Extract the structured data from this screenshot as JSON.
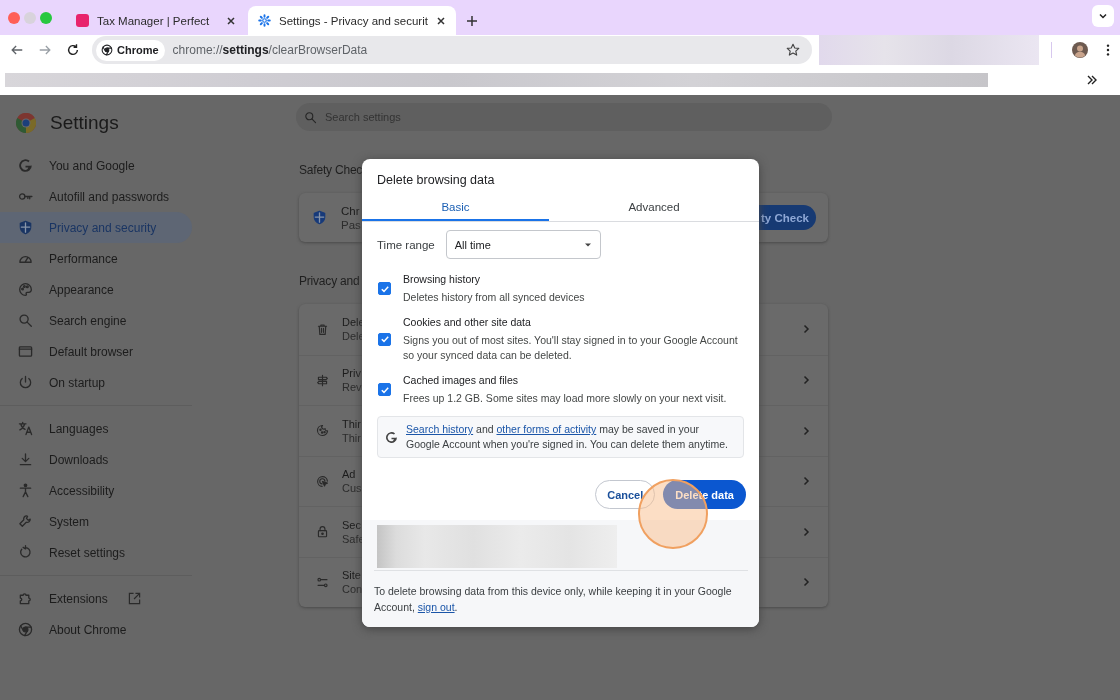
{
  "browser": {
    "tabs": [
      {
        "title": "Tax Manager | Perfect",
        "selected": false
      },
      {
        "title": "Settings - Privacy and securit",
        "selected": true
      }
    ],
    "omnibox": {
      "chip": "Chrome",
      "url": "chrome://**settings**/clearBrowserData"
    }
  },
  "settings": {
    "title": "Settings",
    "search": {
      "placeholder": "Search settings"
    },
    "sidebar": {
      "groups": [
        [
          {
            "label": "You and Google",
            "selected": false
          },
          {
            "label": "Autofill and passwords",
            "selected": false
          },
          {
            "label": "Privacy and security",
            "selected": true
          },
          {
            "label": "Performance",
            "selected": false
          },
          {
            "label": "Appearance",
            "selected": false
          },
          {
            "label": "Search engine",
            "selected": false
          },
          {
            "label": "Default browser",
            "selected": false
          },
          {
            "label": "On startup",
            "selected": false
          }
        ],
        [
          {
            "label": "Languages",
            "selected": false
          },
          {
            "label": "Downloads",
            "selected": false
          },
          {
            "label": "Accessibility",
            "selected": false
          },
          {
            "label": "System",
            "selected": false
          },
          {
            "label": "Reset settings",
            "selected": false
          }
        ],
        [
          {
            "label": "Extensions",
            "selected": false,
            "external": true
          },
          {
            "label": "About Chrome",
            "selected": false
          }
        ]
      ]
    },
    "safety_check": {
      "heading": "Safety Chec",
      "card_title": "Chr",
      "card_subtitle": "Pas",
      "button": "ty Check"
    },
    "privacy": {
      "heading": "Privacy and",
      "rows": [
        {
          "title": "Dele",
          "subtitle": "Dele"
        },
        {
          "title": "Priv",
          "subtitle": "Rev"
        },
        {
          "title": "Thir",
          "subtitle": "Thir"
        },
        {
          "title": "Ad",
          "subtitle": "Cus"
        },
        {
          "title": "Sec",
          "subtitle": "Safe"
        },
        {
          "title": "Site",
          "subtitle": "Con"
        }
      ]
    }
  },
  "dialog": {
    "title": "Delete browsing data",
    "tabs": [
      {
        "label": "Basic",
        "selected": true
      },
      {
        "label": "Advanced",
        "selected": false
      }
    ],
    "time_range": {
      "label": "Time range",
      "value": "All time"
    },
    "options": [
      {
        "title": "Browsing history",
        "description": "Deletes history from all synced devices",
        "checked": true
      },
      {
        "title": "Cookies and other site data",
        "description": "Signs you out of most sites. You'll stay signed in to your Google Account so your synced data can be deleted.",
        "checked": true
      },
      {
        "title": "Cached images and files",
        "description": "Frees up 1.2 GB. Some sites may load more slowly on your next visit.",
        "checked": true
      }
    ],
    "notice": [
      {
        "text": "Search history",
        "link": true
      },
      {
        "text": " and ",
        "link": false
      },
      {
        "text": "other forms of activity",
        "link": true
      },
      {
        "text": " may be saved in your Google Account when you're signed in. You can delete them anytime.",
        "link": false
      }
    ],
    "buttons": [
      {
        "label": "Cancel",
        "kind": "secondary"
      },
      {
        "label": "Delete data",
        "kind": "primary"
      }
    ],
    "footer": [
      {
        "text": "To delete browsing data from this device only, while keeping it in your Google Account, ",
        "link": false
      },
      {
        "text": "sign out",
        "link": true
      },
      {
        "text": ".",
        "link": false
      }
    ]
  }
}
